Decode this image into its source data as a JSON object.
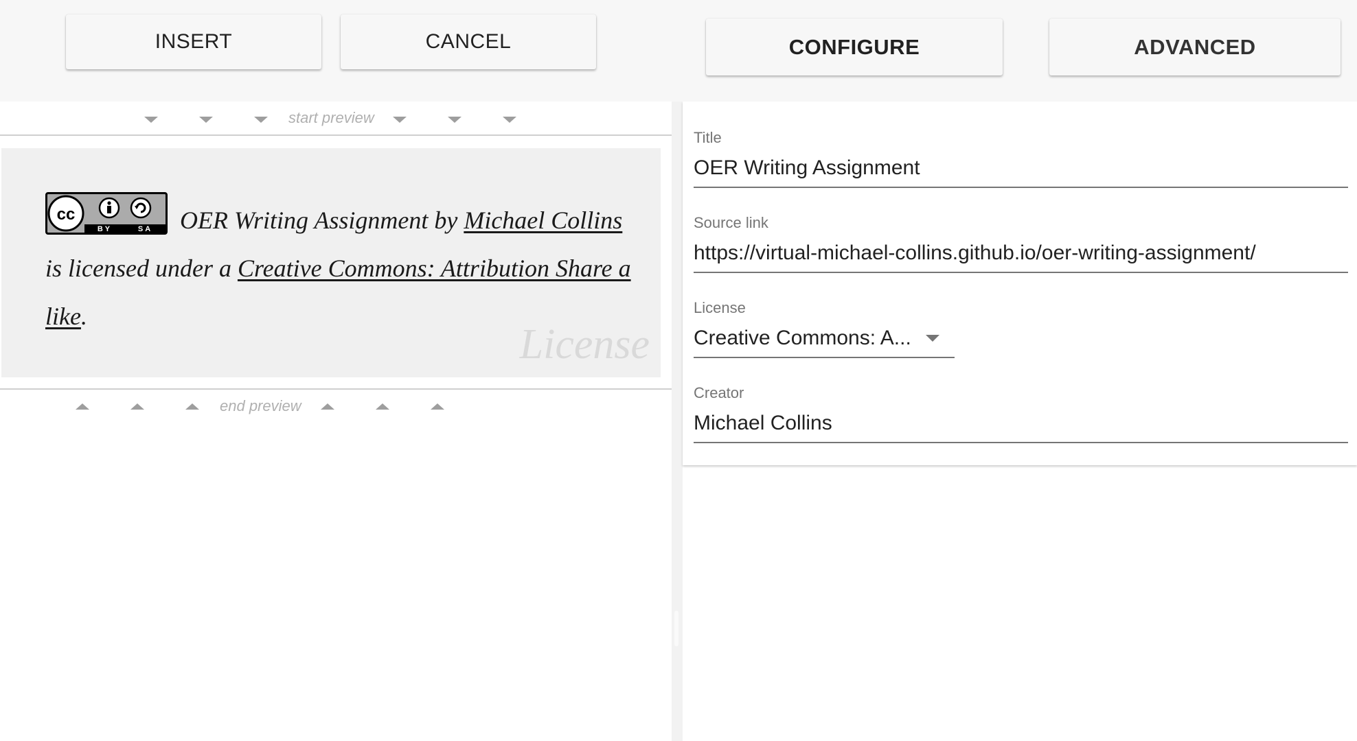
{
  "toolbar": {
    "insert_label": "INSERT",
    "cancel_label": "CANCEL",
    "configure_label": "CONFIGURE",
    "advanced_label": "ADVANCED"
  },
  "preview": {
    "start_marker": "start preview",
    "end_marker": "end preview",
    "badge_by": "BY",
    "badge_sa": "SA",
    "title": "OER Writing Assignment",
    "by_text": "by",
    "creator_link": "Michael Collins",
    "licensed_text": "is licensed under a",
    "license_link": "Creative Commons: Attribution Share a like",
    "period": ".",
    "watermark": "License"
  },
  "config": {
    "title_label": "Title",
    "title_value": "OER Writing Assignment",
    "source_label": "Source link",
    "source_value": "https://virtual-michael-collins.github.io/oer-writing-assignment/",
    "license_label": "License",
    "license_value": "Creative Commons: A...",
    "creator_label": "Creator",
    "creator_value": "Michael Collins"
  }
}
